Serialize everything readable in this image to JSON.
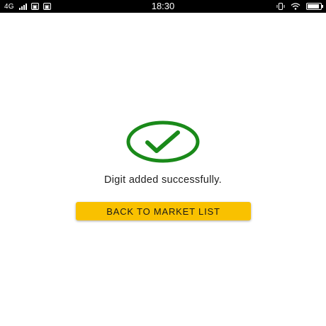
{
  "status_bar": {
    "network": "4G",
    "time": "18:30",
    "battery_level": 0.9,
    "icons": [
      "signal-icon",
      "app-notification-icon",
      "app-notification-icon",
      "vibrate-icon",
      "wifi-icon",
      "battery-icon"
    ]
  },
  "success": {
    "icon": "check-circle-icon",
    "icon_color": "#1a8a1a",
    "message": "Digit added successfully."
  },
  "actions": {
    "back_label": "BACK TO MARKET LIST",
    "button_color": "#f9c100"
  }
}
